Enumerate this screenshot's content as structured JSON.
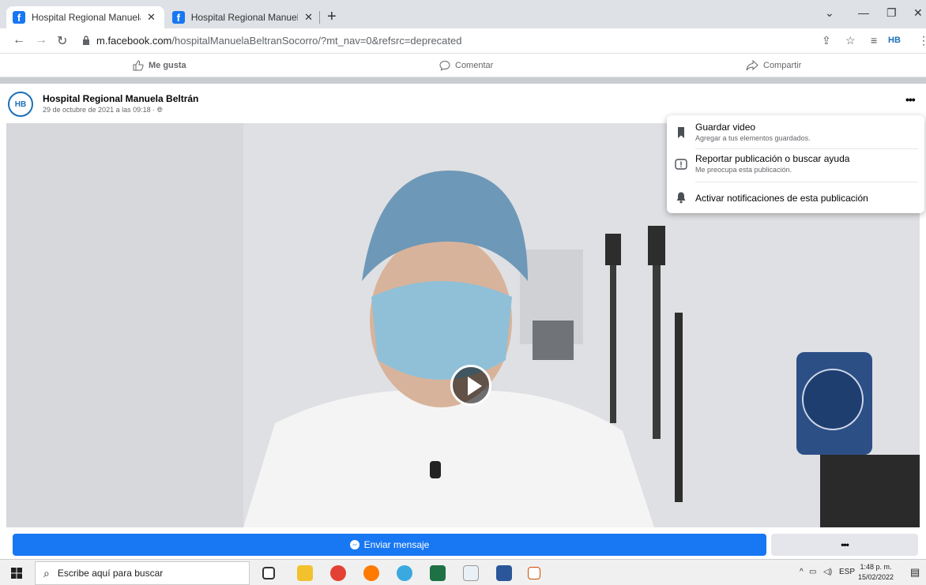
{
  "browser": {
    "tabs": [
      {
        "title": "Hospital Regional Manuela Beltrá",
        "active": true
      },
      {
        "title": "Hospital Regional Manuela Beltrá",
        "active": false
      }
    ],
    "url_host": "m.facebook.com",
    "url_path": "/hospitalManuelaBeltranSocorro/?mt_nav=0&refsrc=deprecated"
  },
  "actions": {
    "like": "Me gusta",
    "comment": "Comentar",
    "share": "Compartir"
  },
  "post": {
    "author": "Hospital Regional Manuela Beltrán",
    "date": "29 de octubre de 2021 a las 09:18 ·",
    "avatar_text": "HB",
    "more": "•••"
  },
  "menu": {
    "items": [
      {
        "title": "Guardar video",
        "subtitle": "Agregar a tus elementos guardados.",
        "icon": "bookmark-icon"
      },
      {
        "title": "Reportar publicación o buscar ayuda",
        "subtitle": "Me preocupa esta publicación.",
        "icon": "report-icon"
      },
      {
        "title": "Activar notificaciones de esta publicación",
        "subtitle": "",
        "icon": "bell-icon"
      }
    ]
  },
  "bottom": {
    "message_button": "Enviar mensaje",
    "more_button": "•••"
  },
  "taskbar": {
    "search_placeholder": "Escribe aquí para buscar",
    "language": "ESP",
    "time": "1:48 p. m.",
    "date": "15/02/2022"
  },
  "colors": {
    "facebook_blue": "#1877f2",
    "tab_bg": "#dee1e6"
  }
}
